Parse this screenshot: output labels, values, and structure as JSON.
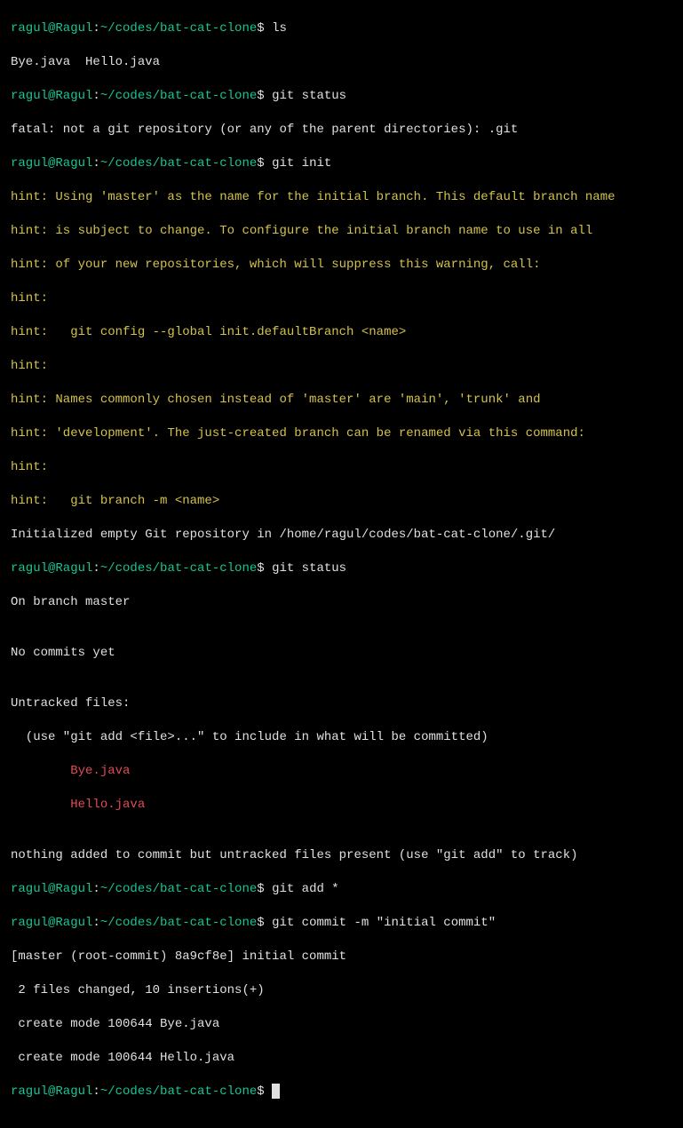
{
  "prompt": {
    "user": "ragul@Ragul",
    "colon": ":",
    "path": "~/codes/bat-cat-clone",
    "dollar": "$"
  },
  "cmds": {
    "ls": " ls",
    "status1": " git status",
    "init": " git init",
    "status2": " git status",
    "add": " git add *",
    "commit": " git commit -m \"initial commit\""
  },
  "out": {
    "lsOut": "Bye.java  Hello.java",
    "fatal": "fatal: not a git repository (or any of the parent directories): .git",
    "hint1": "hint: Using 'master' as the name for the initial branch. This default branch name",
    "hint2": "hint: is subject to change. To configure the initial branch name to use in all",
    "hint3": "hint: of your new repositories, which will suppress this warning, call:",
    "hint4": "hint:",
    "hint5": "hint:   git config --global init.defaultBranch <name>",
    "hint6": "hint:",
    "hint7": "hint: Names commonly chosen instead of 'master' are 'main', 'trunk' and",
    "hint8": "hint: 'development'. The just-created branch can be renamed via this command:",
    "hint9": "hint:",
    "hint10": "hint:   git branch -m <name>",
    "initialized": "Initialized empty Git repository in /home/ragul/codes/bat-cat-clone/.git/",
    "onBranch": "On branch master",
    "blank": "",
    "noCommits": "No commits yet",
    "untrackedHeader": "Untracked files:",
    "useAdd": "  (use \"git add <file>...\" to include in what will be committed)",
    "bye": "        Bye.java",
    "hello": "        Hello.java",
    "nothingAdded": "nothing added to commit but untracked files present (use \"git add\" to track)",
    "commitLine1": "[master (root-commit) 8a9cf8e] initial commit",
    "commitLine2": " 2 files changed, 10 insertions(+)",
    "commitLine3": " create mode 100644 Bye.java",
    "commitLine4": " create mode 100644 Hello.java"
  }
}
